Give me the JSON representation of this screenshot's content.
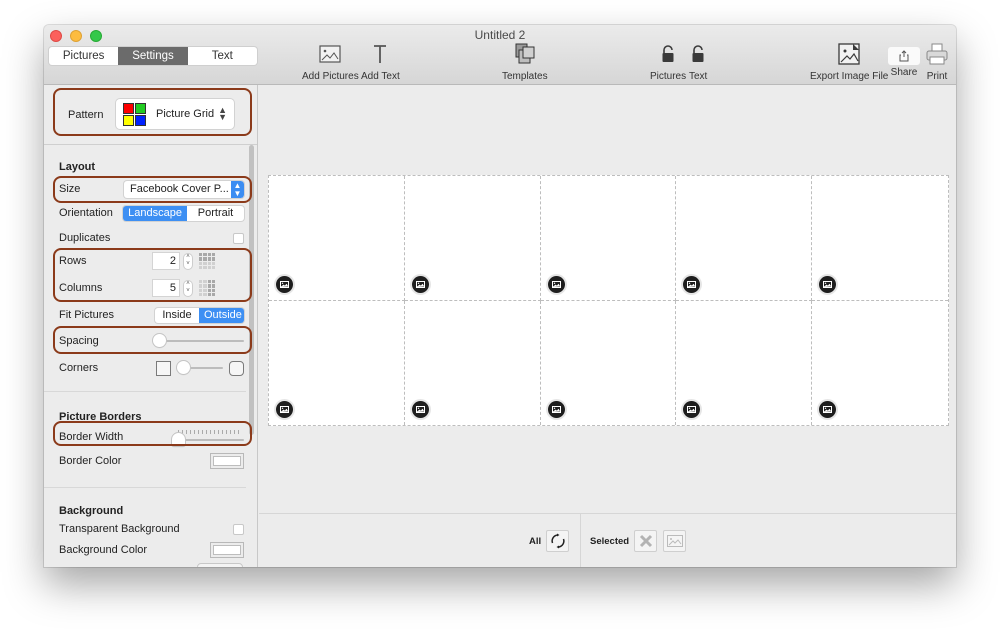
{
  "window": {
    "title": "Untitled 2"
  },
  "toolbar": {
    "tabs": [
      {
        "label": "Pictures",
        "active": false
      },
      {
        "label": "Settings",
        "active": true
      },
      {
        "label": "Text",
        "active": false
      }
    ],
    "buttons": {
      "add_pictures": "Add Pictures",
      "add_text": "Add Text",
      "templates": "Templates",
      "lock_pictures": "Pictures",
      "lock_text": "Text",
      "export_image_file": "Export Image File",
      "share": "Share",
      "print": "Print"
    }
  },
  "sidebar": {
    "pattern": {
      "label": "Pattern",
      "value": "Picture Grid",
      "swatch_colors": [
        "#ff0000",
        "#22cc22",
        "#ffff00",
        "#0022ff"
      ]
    },
    "layout": {
      "title": "Layout",
      "size": {
        "label": "Size",
        "value": "Facebook Cover P..."
      },
      "orientation": {
        "label": "Orientation",
        "options": [
          "Landscape",
          "Portrait"
        ],
        "selected": "Landscape"
      },
      "duplicates": {
        "label": "Duplicates",
        "checked": false
      },
      "rows": {
        "label": "Rows",
        "value": "2"
      },
      "columns": {
        "label": "Columns",
        "value": "5"
      },
      "fit_pictures": {
        "label": "Fit Pictures",
        "options": [
          "Inside",
          "Outside"
        ],
        "selected": "Outside"
      },
      "spacing": {
        "label": "Spacing",
        "value": 0
      },
      "corners": {
        "label": "Corners",
        "value": 0
      }
    },
    "picture_borders": {
      "title": "Picture Borders",
      "border_width": {
        "label": "Border Width",
        "value": 0
      },
      "border_color": {
        "label": "Border Color",
        "color": "#ffffff"
      }
    },
    "background": {
      "title": "Background",
      "transparent": {
        "label": "Transparent Background",
        "checked": false
      },
      "background_color": {
        "label": "Background Color",
        "color": "#ffffff"
      }
    }
  },
  "canvas": {
    "rows": 2,
    "columns": 5
  },
  "bottombar": {
    "all_label": "All",
    "selected_label": "Selected"
  },
  "colors": {
    "accent": "#3d8ff3",
    "highlight_outline": "#8b3a1a"
  }
}
